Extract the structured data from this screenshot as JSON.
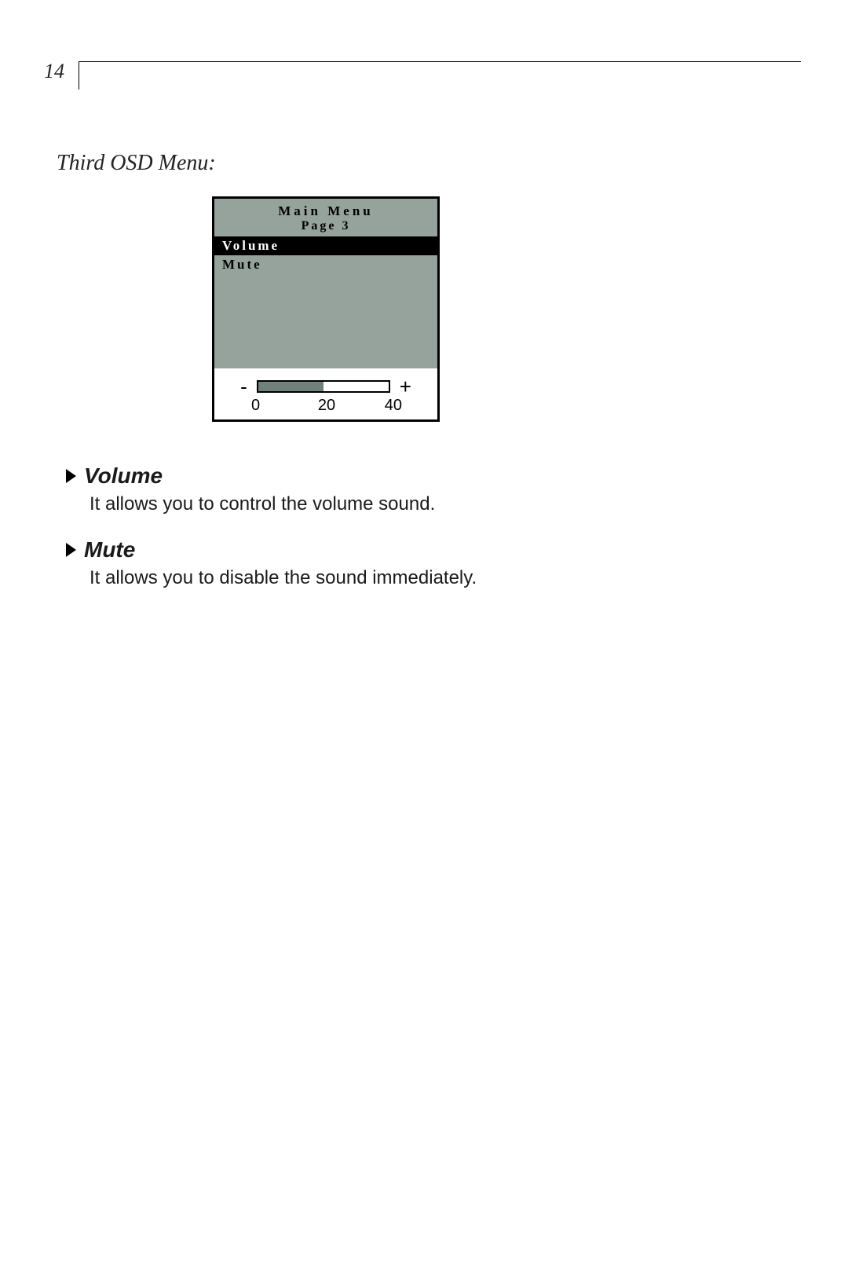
{
  "page_number": "14",
  "heading": "Third OSD Menu:",
  "osd": {
    "title": "Main Menu",
    "subtitle": "Page 3",
    "items": [
      {
        "label": "Volume",
        "selected": true
      },
      {
        "label": "Mute",
        "selected": false
      }
    ],
    "slider": {
      "minus": "-",
      "plus": "+",
      "ticks": [
        "0",
        "20",
        "40"
      ],
      "min": 0,
      "max": 40,
      "value": 20
    }
  },
  "entries": [
    {
      "title": "Volume",
      "desc": "It allows you to control the volume sound."
    },
    {
      "title": "Mute",
      "desc": "It allows you to disable the sound immediately."
    }
  ]
}
